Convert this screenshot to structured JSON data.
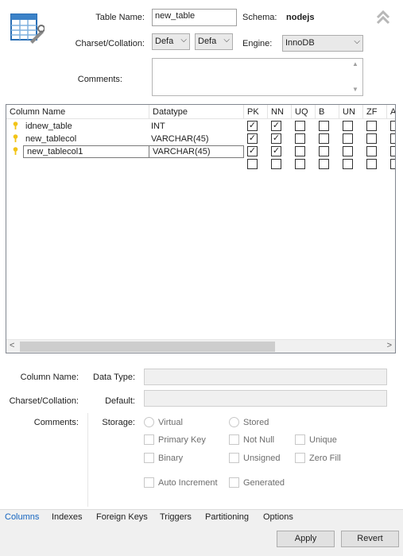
{
  "table_form": {
    "table_name_label": "Table Name:",
    "table_name_value": "new_table",
    "schema_label": "Schema:",
    "schema_value": "nodejs",
    "charset_label": "Charset/Collation:",
    "charset_value": "Defa",
    "collation_value": "Defa",
    "engine_label": "Engine:",
    "engine_value": "InnoDB",
    "comments_label": "Comments:",
    "comments_value": ""
  },
  "grid": {
    "headers": [
      "Column Name",
      "Datatype",
      "PK",
      "NN",
      "UQ",
      "B",
      "UN",
      "ZF",
      "A"
    ],
    "rows": [
      {
        "name": "idnew_table",
        "type": "INT",
        "pk": true,
        "nn": true,
        "uq": false,
        "b": false,
        "un": false,
        "zf": false
      },
      {
        "name": "new_tablecol",
        "type": "VARCHAR(45)",
        "pk": true,
        "nn": true,
        "uq": false,
        "b": false,
        "un": false,
        "zf": false
      },
      {
        "name": "new_tablecol1",
        "type": "VARCHAR(45)",
        "pk": true,
        "nn": true,
        "uq": false,
        "b": false,
        "un": false,
        "zf": false
      }
    ]
  },
  "details": {
    "column_name_label": "Column Name:",
    "data_type_label": "Data Type:",
    "charset_label": "Charset/Collation:",
    "default_label": "Default:",
    "comments_label": "Comments:",
    "storage_label": "Storage:",
    "virtual_label": "Virtual",
    "stored_label": "Stored",
    "primary_key_label": "Primary Key",
    "not_null_label": "Not Null",
    "unique_label": "Unique",
    "binary_label": "Binary",
    "unsigned_label": "Unsigned",
    "zero_fill_label": "Zero Fill",
    "auto_increment_label": "Auto Increment",
    "generated_label": "Generated"
  },
  "tabs": [
    "Columns",
    "Indexes",
    "Foreign Keys",
    "Triggers",
    "Partitioning",
    "Options"
  ],
  "buttons": {
    "apply": "Apply",
    "revert": "Revert"
  },
  "colors": {
    "active_tab": "#1565c0",
    "key_icon": "#f2c416"
  }
}
